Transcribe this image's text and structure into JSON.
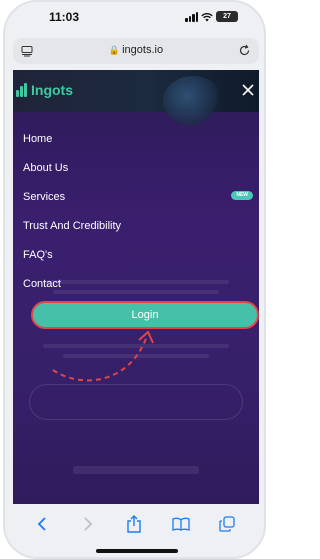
{
  "status_bar": {
    "time": "11:03",
    "battery": "27"
  },
  "address_bar": {
    "url": "ingots.io"
  },
  "header": {
    "logo_text": "Ingots"
  },
  "menu": {
    "items": [
      {
        "label": "Home"
      },
      {
        "label": "About Us"
      },
      {
        "label": "Services",
        "badge": "NEW"
      },
      {
        "label": "Trust And Credibility"
      },
      {
        "label": "FAQ's"
      },
      {
        "label": "Contact"
      }
    ],
    "login_label": "Login"
  },
  "colors": {
    "accent": "#46c0a8",
    "logo": "#3ec9a0",
    "highlight": "#e24545",
    "page_bg": "#3a1f6e",
    "toolbar_icon": "#1b7cf5"
  }
}
